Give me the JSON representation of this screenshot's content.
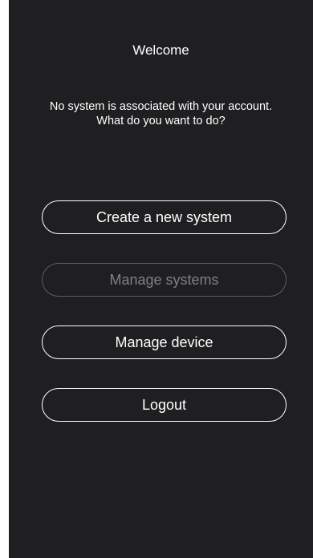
{
  "header": {
    "title": "Welcome"
  },
  "message": {
    "line1": "No system is associated with your account.",
    "line2": "What do you want to do?"
  },
  "actions": {
    "create_system": "Create a new system",
    "manage_systems": "Manage systems",
    "manage_device": "Manage device",
    "logout": "Logout"
  },
  "colors": {
    "background": "#1f1f21",
    "text": "#ffffff",
    "disabled_text": "#808083",
    "disabled_border": "#5d5d60"
  }
}
